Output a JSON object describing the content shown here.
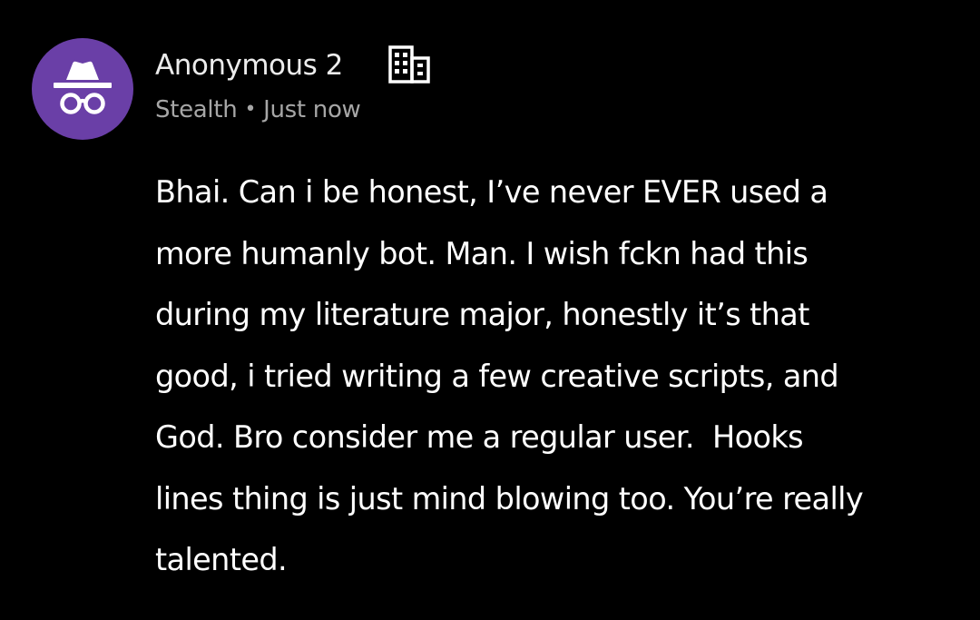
{
  "post": {
    "author": {
      "name": "Anonymous 2",
      "avatar_icon": "incognito-icon",
      "avatar_color": "#6a3fa7",
      "badge_icon": "company-building-icon"
    },
    "meta": {
      "company": "Stealth",
      "separator": "•",
      "timestamp": "Just now"
    },
    "body": "Bhai. Can i be honest, I’ve never EVER used a\nmore humanly bot. Man. I wish fckn had this\nduring my literature major, honestly it’s that\ngood, i tried writing a few creative scripts, and\nGod. Bro consider me a regular user.  Hooks\nlines thing is just mind blowing too. You’re really\ntalented."
  },
  "colors": {
    "background": "#000000",
    "name_text": "#ececec",
    "meta_text": "#a6a6a6",
    "body_text": "#ffffff"
  }
}
